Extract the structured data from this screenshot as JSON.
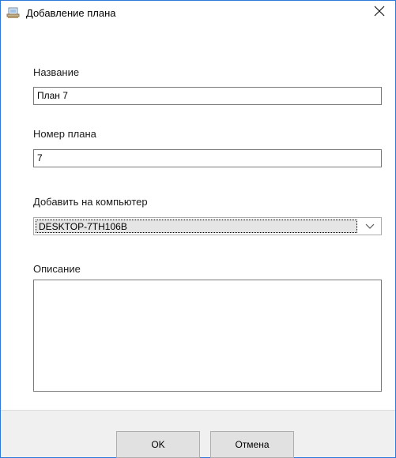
{
  "window": {
    "title": "Добавление плана",
    "title_icon": "plan-window-icon",
    "close_icon": "close-icon"
  },
  "form": {
    "name_label": "Название",
    "name_value": "План 7",
    "number_label": "Номер плана",
    "number_value": "7",
    "computer_label": "Добавить на компьютер",
    "computer_value": "DESKTOP-7TH106B",
    "description_label": "Описание",
    "description_value": ""
  },
  "buttons": {
    "ok_label": "OK",
    "cancel_label": "Отмена"
  },
  "colors": {
    "window_border": "#2b79d8",
    "footer_bg": "#f0f0f0",
    "button_bg": "#e1e1e1",
    "selected_combo_bg": "#e5e5e5"
  }
}
